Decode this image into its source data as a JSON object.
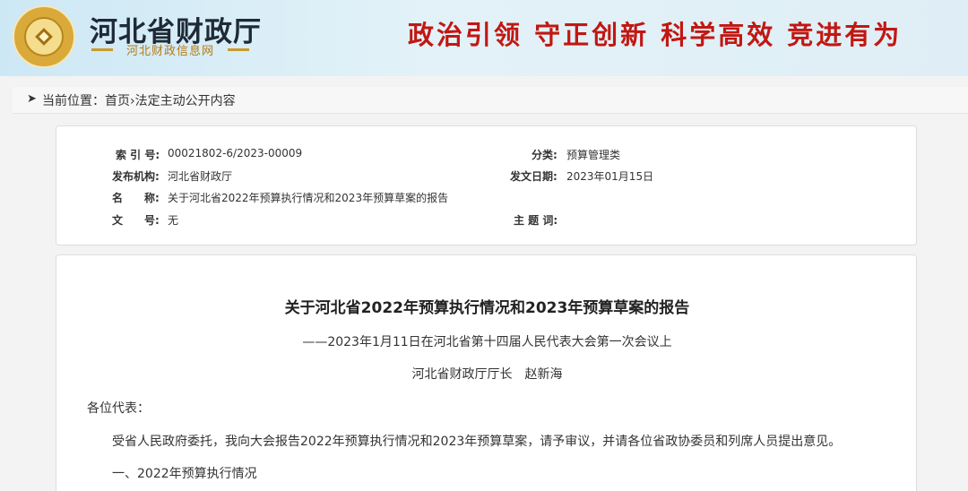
{
  "header": {
    "site_name": "河北省财政厅",
    "site_sub": "河北财政信息网",
    "slogan": "政治引领  守正创新  科学高效  竞进有为"
  },
  "breadcrumb": {
    "prefix": "当前位置：",
    "home": "首页",
    "separator": "›",
    "current": "法定主动公开内容"
  },
  "meta": {
    "index_label": "索 引 号:",
    "index_value": "00021802-6/2023-00009",
    "category_label": "分类:",
    "category_value": "预算管理类",
    "publisher_label": "发布机构:",
    "publisher_value": "河北省财政厅",
    "date_label": "发文日期:",
    "date_value": "2023年01月15日",
    "name_label": "名　　称:",
    "name_value": "关于河北省2022年预算执行情况和2023年预算草案的报告",
    "docno_label": "文　　号:",
    "docno_value": "无",
    "subject_label": "主 题 词:",
    "subject_value": ""
  },
  "article": {
    "title": "关于河北省2022年预算执行情况和2023年预算草案的报告",
    "subtitle": "——2023年1月11日在河北省第十四届人民代表大会第一次会议上",
    "author": "河北省财政厅厅长　赵新海",
    "salutation": "各位代表：",
    "para1": "受省人民政府委托，我向大会报告2022年预算执行情况和2023年预算草案，请予审议，并请各位省政协委员和列席人员提出意见。",
    "section1": "一、2022年预算执行情况"
  }
}
